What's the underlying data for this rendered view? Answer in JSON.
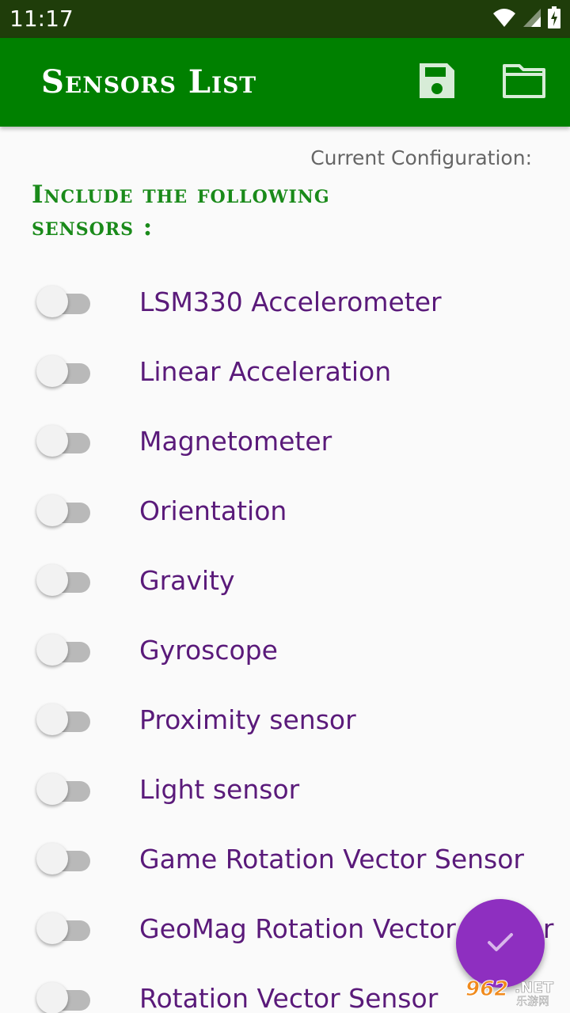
{
  "status_bar": {
    "time": "11:17",
    "icons": [
      "wifi-icon",
      "cell-signal-icon",
      "battery-charging-icon"
    ]
  },
  "app_bar": {
    "title": "Sensors List",
    "actions": [
      {
        "name": "save-icon"
      },
      {
        "name": "folder-icon"
      }
    ]
  },
  "config_label": "Current Configuration:",
  "section_heading": "Include the following sensors :",
  "sensors": [
    {
      "label": "LSM330 Accelerometer",
      "enabled": false
    },
    {
      "label": "Linear Acceleration",
      "enabled": false
    },
    {
      "label": "Magnetometer",
      "enabled": false
    },
    {
      "label": "Orientation",
      "enabled": false
    },
    {
      "label": "Gravity",
      "enabled": false
    },
    {
      "label": "Gyroscope",
      "enabled": false
    },
    {
      "label": "Proximity sensor",
      "enabled": false
    },
    {
      "label": "Light sensor",
      "enabled": false
    },
    {
      "label": "Game Rotation Vector Sensor",
      "enabled": false
    },
    {
      "label": "GeoMag Rotation Vector Sensor",
      "enabled": false
    },
    {
      "label": "Rotation Vector Sensor",
      "enabled": false
    }
  ],
  "fab": {
    "icon": "check-icon"
  },
  "watermark": {
    "text": "962.NET 乐游网"
  },
  "colors": {
    "status_bar": "#1f3d0a",
    "app_bar": "#008000",
    "heading": "#1a8a1a",
    "sensor_text": "#5a1a7a",
    "fab": "#8e2fc0"
  }
}
